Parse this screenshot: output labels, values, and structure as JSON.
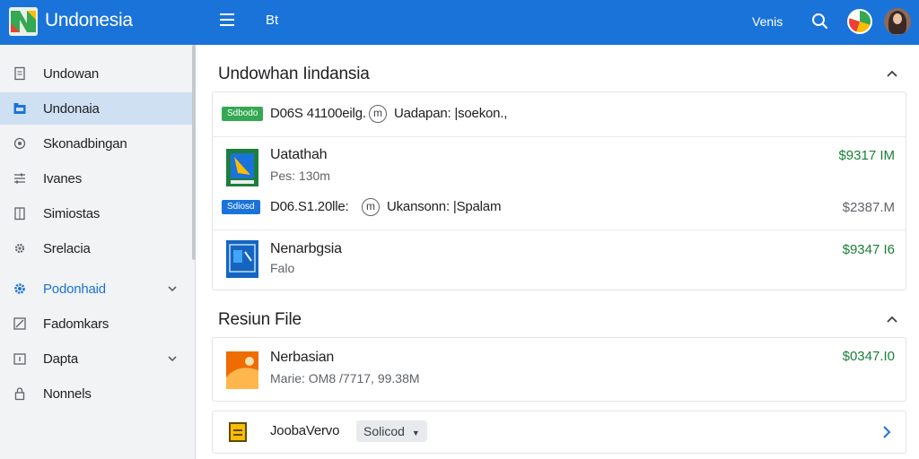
{
  "header": {
    "app_title": "Undonesia",
    "nav_tab": "Bt",
    "top_link": "Venis"
  },
  "sidebar": {
    "items": [
      {
        "label": "Undowan",
        "icon": "document-icon"
      },
      {
        "label": "Undonaia",
        "icon": "folder-icon"
      },
      {
        "label": "Skonadbingan",
        "icon": "settings-icon"
      },
      {
        "label": "Ivanes",
        "icon": "sliders-icon"
      },
      {
        "label": "Simiostas",
        "icon": "clipboard-icon"
      },
      {
        "label": "Srelacia",
        "icon": "gear-icon"
      },
      {
        "label": "Podonhaid",
        "icon": "cog-blue-icon"
      },
      {
        "label": "Fadomkars",
        "icon": "pencil-icon"
      },
      {
        "label": "Dapta",
        "icon": "calendar-icon"
      },
      {
        "label": "Nonnels",
        "icon": "lock-icon"
      }
    ]
  },
  "main": {
    "section1": {
      "title": "Undowhan Iindansia",
      "row1": {
        "tag": "Sdbodo",
        "text": "D06S 41100eilg.",
        "circle": "m",
        "suffix": "Uadapan: |soekon.,"
      },
      "item1": {
        "name": "Uatathah",
        "meta": "Pes: 130m",
        "price": "$9317 IM"
      },
      "row2": {
        "tag": "Sdiosd",
        "text": "D06.S1.20lle:",
        "circle": "m",
        "suffix": "Ukansonn: |Spalam",
        "price": "$2387.M"
      },
      "item2": {
        "name": "Nenarbgsia",
        "meta": "Falo",
        "price": "$9347 I6"
      }
    },
    "section2": {
      "title": "Resiun File",
      "item1": {
        "name": "Nerbasian",
        "meta": "Marie: OM8 /7717, 99.38M",
        "price": "$0347.I0"
      },
      "item2": {
        "name": "JoobaVervo",
        "chip": "Solicod"
      }
    }
  },
  "colors": {
    "accent": "#1a73d9",
    "price_green": "#188038",
    "tag_green": "#34a853"
  }
}
